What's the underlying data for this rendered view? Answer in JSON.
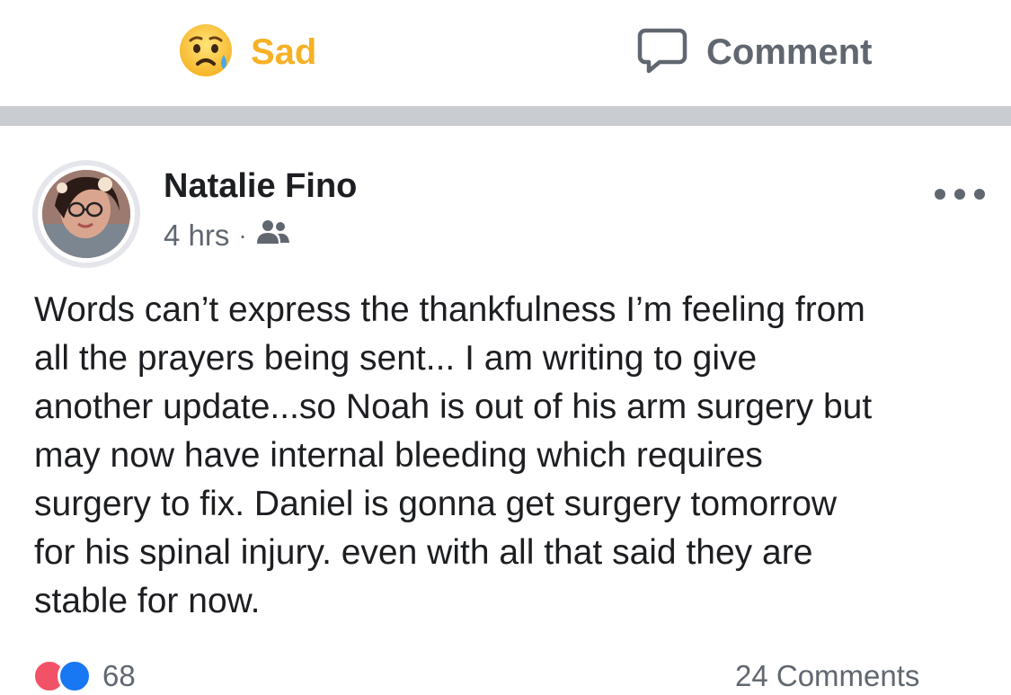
{
  "actions": {
    "sad_label": "Sad",
    "comment_label": "Comment",
    "sad_color": "#f7b125",
    "comment_color": "#606770"
  },
  "post": {
    "author": "Natalie Fino",
    "time": "4 hrs",
    "separator": "·",
    "audience_icon": "friends-icon",
    "text": "Words can’t express the thankfulness I’m feeling from\nall the prayers being sent... I am writing to give\nanother update...so Noah is out of his arm surgery but\nmay now have internal bleeding which requires\nsurgery to fix. Daniel is gonna get surgery tomorrow\nfor his spinal injury. even with all that said they are\nstable for now.",
    "reaction_count": "68",
    "comments_label": "24 Comments"
  },
  "colors": {
    "divider": "#c9ccd1",
    "text": "#1c1e21",
    "secondary": "#606770",
    "love": "#f25268",
    "like": "#1877f2"
  }
}
